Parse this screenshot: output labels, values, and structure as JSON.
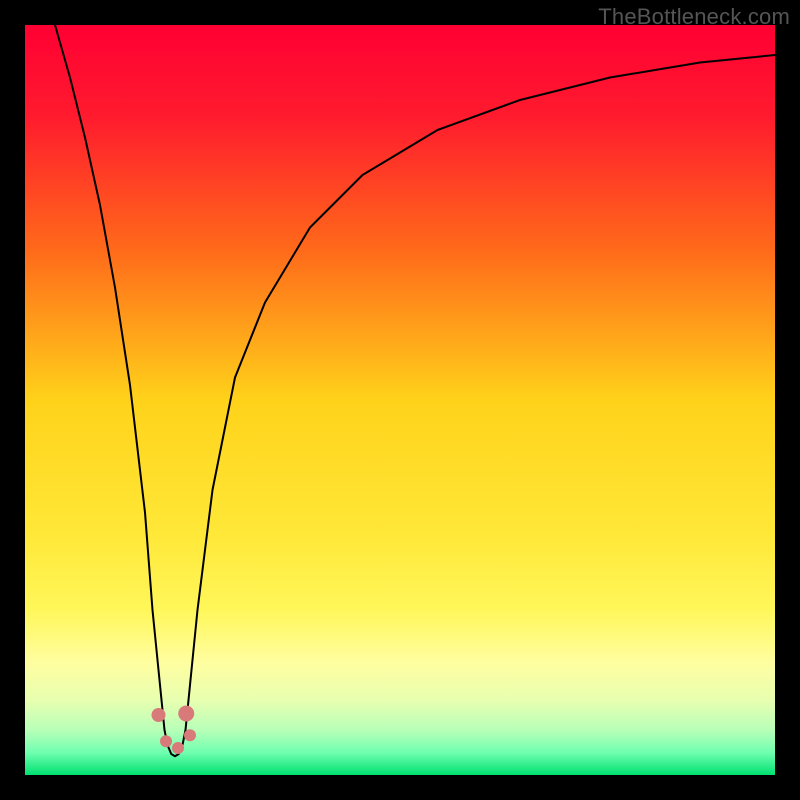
{
  "watermark": "TheBottleneck.com",
  "chart_data": {
    "type": "line",
    "title": "",
    "xlabel": "",
    "ylabel": "",
    "xlim": [
      0,
      100
    ],
    "ylim": [
      0,
      100
    ],
    "axes_visible": false,
    "grid": false,
    "legend": false,
    "background_gradient": [
      {
        "pos": 0.0,
        "color": "#ff0033"
      },
      {
        "pos": 0.12,
        "color": "#ff1a2e"
      },
      {
        "pos": 0.3,
        "color": "#ff6a1a"
      },
      {
        "pos": 0.5,
        "color": "#ffd21a"
      },
      {
        "pos": 0.68,
        "color": "#ffe838"
      },
      {
        "pos": 0.78,
        "color": "#fff75a"
      },
      {
        "pos": 0.85,
        "color": "#fffea0"
      },
      {
        "pos": 0.9,
        "color": "#e8ffb0"
      },
      {
        "pos": 0.94,
        "color": "#b8ffb8"
      },
      {
        "pos": 0.97,
        "color": "#70ffb0"
      },
      {
        "pos": 1.0,
        "color": "#00e070"
      }
    ],
    "series": [
      {
        "name": "left-branch",
        "stroke": "#000000",
        "stroke_width": 2,
        "x": [
          4,
          6,
          8,
          10,
          12,
          14,
          16,
          17,
          18,
          18.6
        ],
        "y": [
          100,
          93,
          85,
          76,
          65,
          52,
          35,
          22,
          12,
          6
        ]
      },
      {
        "name": "right-branch",
        "stroke": "#000000",
        "stroke_width": 2,
        "x": [
          21.4,
          22,
          23,
          25,
          28,
          32,
          38,
          45,
          55,
          66,
          78,
          90,
          100
        ],
        "y": [
          6,
          12,
          22,
          38,
          53,
          63,
          73,
          80,
          86,
          90,
          93,
          95,
          96
        ]
      },
      {
        "name": "valley-arc",
        "stroke": "#000000",
        "stroke_width": 2,
        "x": [
          18.6,
          19.0,
          19.5,
          20.0,
          20.5,
          21.0,
          21.4
        ],
        "y": [
          6.0,
          4.0,
          2.8,
          2.5,
          2.8,
          4.0,
          6.0
        ]
      }
    ],
    "markers": [
      {
        "name": "valley-marker-left",
        "x": 17.8,
        "y": 8.0,
        "r": 7,
        "fill": "#d87a7a"
      },
      {
        "name": "valley-marker-center",
        "x": 21.5,
        "y": 8.2,
        "r": 8,
        "fill": "#d87a7a"
      },
      {
        "name": "valley-marker-bottom1",
        "x": 18.8,
        "y": 4.5,
        "r": 6,
        "fill": "#d87a7a"
      },
      {
        "name": "valley-marker-bottom2",
        "x": 20.4,
        "y": 3.6,
        "r": 6,
        "fill": "#d87a7a"
      },
      {
        "name": "valley-marker-right",
        "x": 22.0,
        "y": 5.3,
        "r": 6,
        "fill": "#d87a7a"
      }
    ]
  }
}
